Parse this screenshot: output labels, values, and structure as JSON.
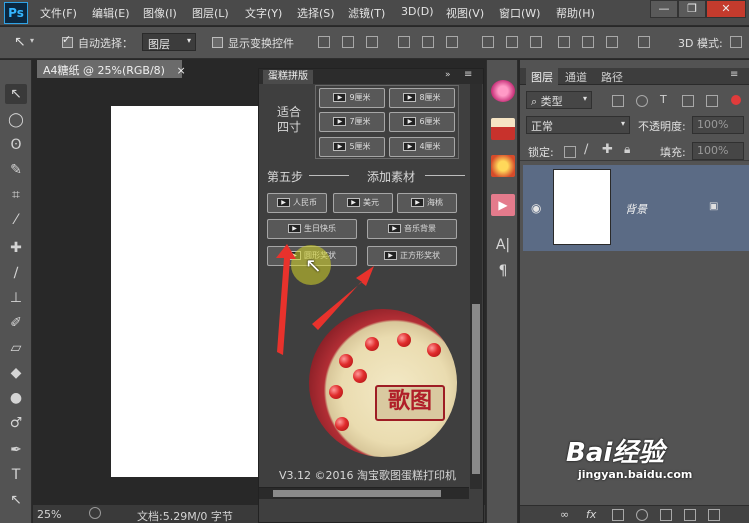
{
  "app": {
    "logo": "Ps"
  },
  "menu": [
    "文件(F)",
    "编辑(E)",
    "图像(I)",
    "图层(L)",
    "文字(Y)",
    "选择(S)",
    "滤镜(T)",
    "3D(D)",
    "视图(V)",
    "窗口(W)",
    "帮助(H)"
  ],
  "window_controls": {
    "minimize": "—",
    "restore": "❐",
    "close": "✕"
  },
  "options_bar": {
    "auto_select_label": "自动选择：",
    "auto_select_value": "图层",
    "show_transform_label": "显示变换控件",
    "mode_label": "3D 模式:"
  },
  "document": {
    "tab_title": "A4糖纸 @ 25%(RGB/8)",
    "tab_close": "×",
    "zoom": "25%",
    "doc_info": "文档:5.29M/0 字节"
  },
  "plugin": {
    "tab": "蛋糕拼版",
    "fit_label": "适合\n四寸",
    "size_buttons": [
      "9厘米",
      "8厘米",
      "7厘米",
      "6厘米",
      "5厘米",
      "4厘米"
    ],
    "step_label": "第五步",
    "add_material_label": "添加素材",
    "material_buttons_row1": [
      "人民币",
      "美元",
      "海桃"
    ],
    "material_buttons_row2": [
      "生日快乐",
      "音乐背景"
    ],
    "material_buttons_row3": [
      "圆形奖状",
      "正方形奖状"
    ],
    "cake_text": "歌图",
    "footer": "V3.12 ©2016 淘宝歌图蛋糕打印机"
  },
  "layers": {
    "tabs": [
      "图层",
      "通道",
      "路径"
    ],
    "filter_kind": "类型",
    "blend_mode": "正常",
    "opacity_label": "不透明度:",
    "opacity_value": "100%",
    "lock_label": "锁定:",
    "fill_label": "填充:",
    "fill_value": "100%",
    "layer_name": "背景"
  },
  "watermark": {
    "brand": "Bai经验",
    "url": "jingyan.baidu.com"
  },
  "colors": {
    "selection_blue": "#5b6b85",
    "annotation_red": "#e8322c",
    "plugin_bg": "#3f3f3f"
  }
}
